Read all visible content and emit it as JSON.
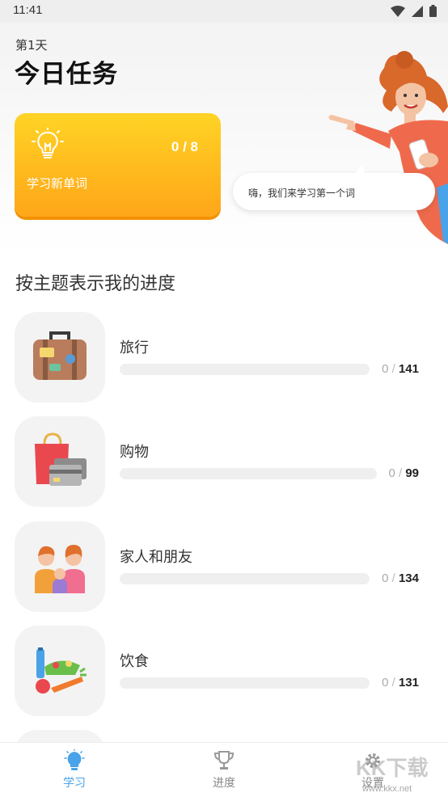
{
  "status": {
    "time": "11:41"
  },
  "header": {
    "day": "第1天",
    "title": "今日任务"
  },
  "task_card": {
    "count": "0 / 8",
    "label": "学习新单词"
  },
  "speech": {
    "text": "嗨，我们来学习第一个词"
  },
  "section": {
    "title": "按主题表示我的进度"
  },
  "topics": [
    {
      "name": "旅行",
      "done": "0",
      "total": "141",
      "progress": 0
    },
    {
      "name": "购物",
      "done": "0",
      "total": "99",
      "progress": 0
    },
    {
      "name": "家人和朋友",
      "done": "0",
      "total": "134",
      "progress": 0
    },
    {
      "name": "饮食",
      "done": "0",
      "total": "131",
      "progress": 0
    }
  ],
  "nav": {
    "learn": "学习",
    "progress": "进度",
    "settings": "设置"
  },
  "watermark": {
    "logo": "KK下载",
    "url": "www.kkx.net"
  },
  "colors": {
    "accent": "#4aa3e8",
    "card_top": "#ffd426",
    "card_bottom": "#ffa61a"
  },
  "icons": [
    "wifi-icon",
    "signal-icon",
    "battery-icon",
    "lightbulb-icon",
    "suitcase-icon",
    "shopping-bag-icon",
    "family-icon",
    "food-icon",
    "trophy-icon",
    "gear-icon"
  ]
}
